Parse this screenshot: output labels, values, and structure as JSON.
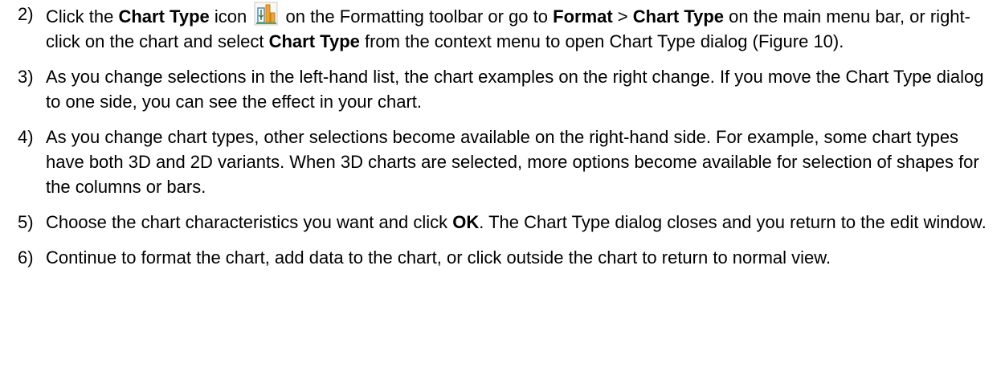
{
  "steps": [
    {
      "number": "2)",
      "p1": "Click the ",
      "b1": "Chart Type",
      "p2": " icon",
      "icon": "chart-type-icon",
      "p3": " on the Formatting toolbar or go to ",
      "b2": "Format",
      "p4": " > ",
      "b3": "Chart Type",
      "p5": " on the main menu bar, or right-click on the chart and select ",
      "b4": "Chart Type",
      "p6": " from the context menu to open Chart Type dialog (Figure 10)."
    },
    {
      "number": "3)",
      "text": "As you change selections in the left-hand list, the chart examples on the right change. If you move the Chart Type dialog to one side, you can see the effect in your chart."
    },
    {
      "number": "4)",
      "text": "As you change chart types, other selections become available on the right-hand side. For example, some chart types have both 3D and 2D variants. When 3D charts are selected, more options become available for selection of shapes for the columns or bars."
    },
    {
      "number": "5)",
      "p1": "Choose the chart characteristics you want and click ",
      "b1": "OK",
      "p2": ". The Chart Type dialog closes and you return to the edit window."
    },
    {
      "number": "6)",
      "text": "Continue to format the chart, add data to the chart, or click outside the chart to return to normal view."
    }
  ],
  "colors": {
    "text": "#000000",
    "background": "#ffffff",
    "icon_orange": "#f2a431",
    "icon_blue": "#4f86c6",
    "icon_green": "#5aa15a"
  }
}
